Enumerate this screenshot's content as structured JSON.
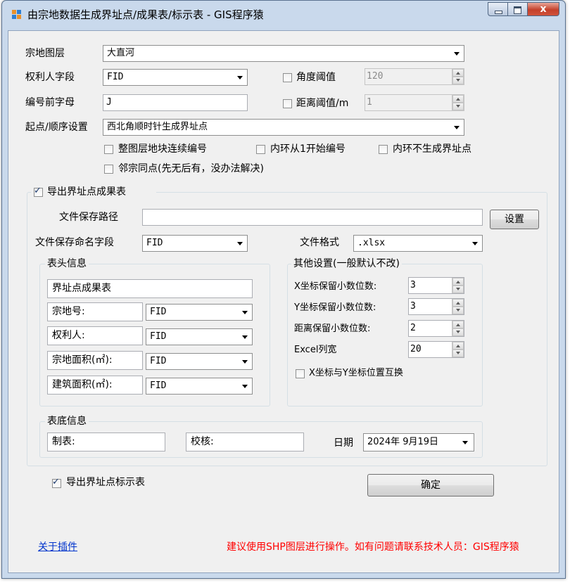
{
  "window": {
    "title": "由宗地数据生成界址点/成果表/标示表 - GIS程序猿",
    "minimize_glyph": "",
    "maximize_glyph": "",
    "close_glyph": "x"
  },
  "colors": {
    "accent_red": "#ff0000",
    "link_blue": "#0033cc",
    "window_frame": "#c9d9ec"
  },
  "top": {
    "layer_label": "宗地图层",
    "layer_value": "大直河",
    "owner_label": "权利人字段",
    "owner_value": "FID",
    "angle_label": "角度阈值",
    "angle_value": "120",
    "prefix_label": "编号前字母",
    "prefix_value": "J",
    "distance_label": "距离阈值/m",
    "distance_value": "1",
    "order_label": "起点/顺序设置",
    "order_value": "西北角顺时针生成界址点",
    "opt_continuous": "整图层地块连续编号",
    "opt_inner_from1": "内环从1开始编号",
    "opt_inner_none": "内环不生成界址点",
    "opt_neighbor": "邻宗同点(先无后有，没办法解决)"
  },
  "result_table": {
    "checkbox_label": "导出界址点成果表",
    "path_label": "文件保存路径",
    "path_value": "",
    "set_button": "设置",
    "name_field_label": "文件保存命名字段",
    "name_field_value": "FID",
    "format_label": "文件格式",
    "format_value": ".xlsx",
    "header_group": "表头信息",
    "header_title_value": "界址点成果表",
    "rows": [
      {
        "label": "宗地号:",
        "field": "FID"
      },
      {
        "label": "权利人:",
        "field": "FID"
      },
      {
        "label": "宗地面积(㎡):",
        "field": "FID"
      },
      {
        "label": "建筑面积(㎡):",
        "field": "FID"
      }
    ],
    "other_group": "其他设置(一般默认不改)",
    "x_decimal_label": "X坐标保留小数位数:",
    "x_decimal_value": "3",
    "y_decimal_label": "Y坐标保留小数位数:",
    "y_decimal_value": "3",
    "dist_decimal_label": "距离保留小数位数:",
    "dist_decimal_value": "2",
    "excel_width_label": "Excel列宽",
    "excel_width_value": "20",
    "swap_label": "X坐标与Y坐标位置互换",
    "footer_group": "表底信息",
    "maker_value": "制表:",
    "checker_value": "校核:",
    "date_label": "日期",
    "date_value": "2024年  9月19日"
  },
  "bottom": {
    "export_marker_label": "导出界址点标示表",
    "ok_button": "确定",
    "about_link": "关于插件",
    "notice": "建议使用SHP图层进行操作。如有问题请联系技术人员：GIS程序猿"
  }
}
